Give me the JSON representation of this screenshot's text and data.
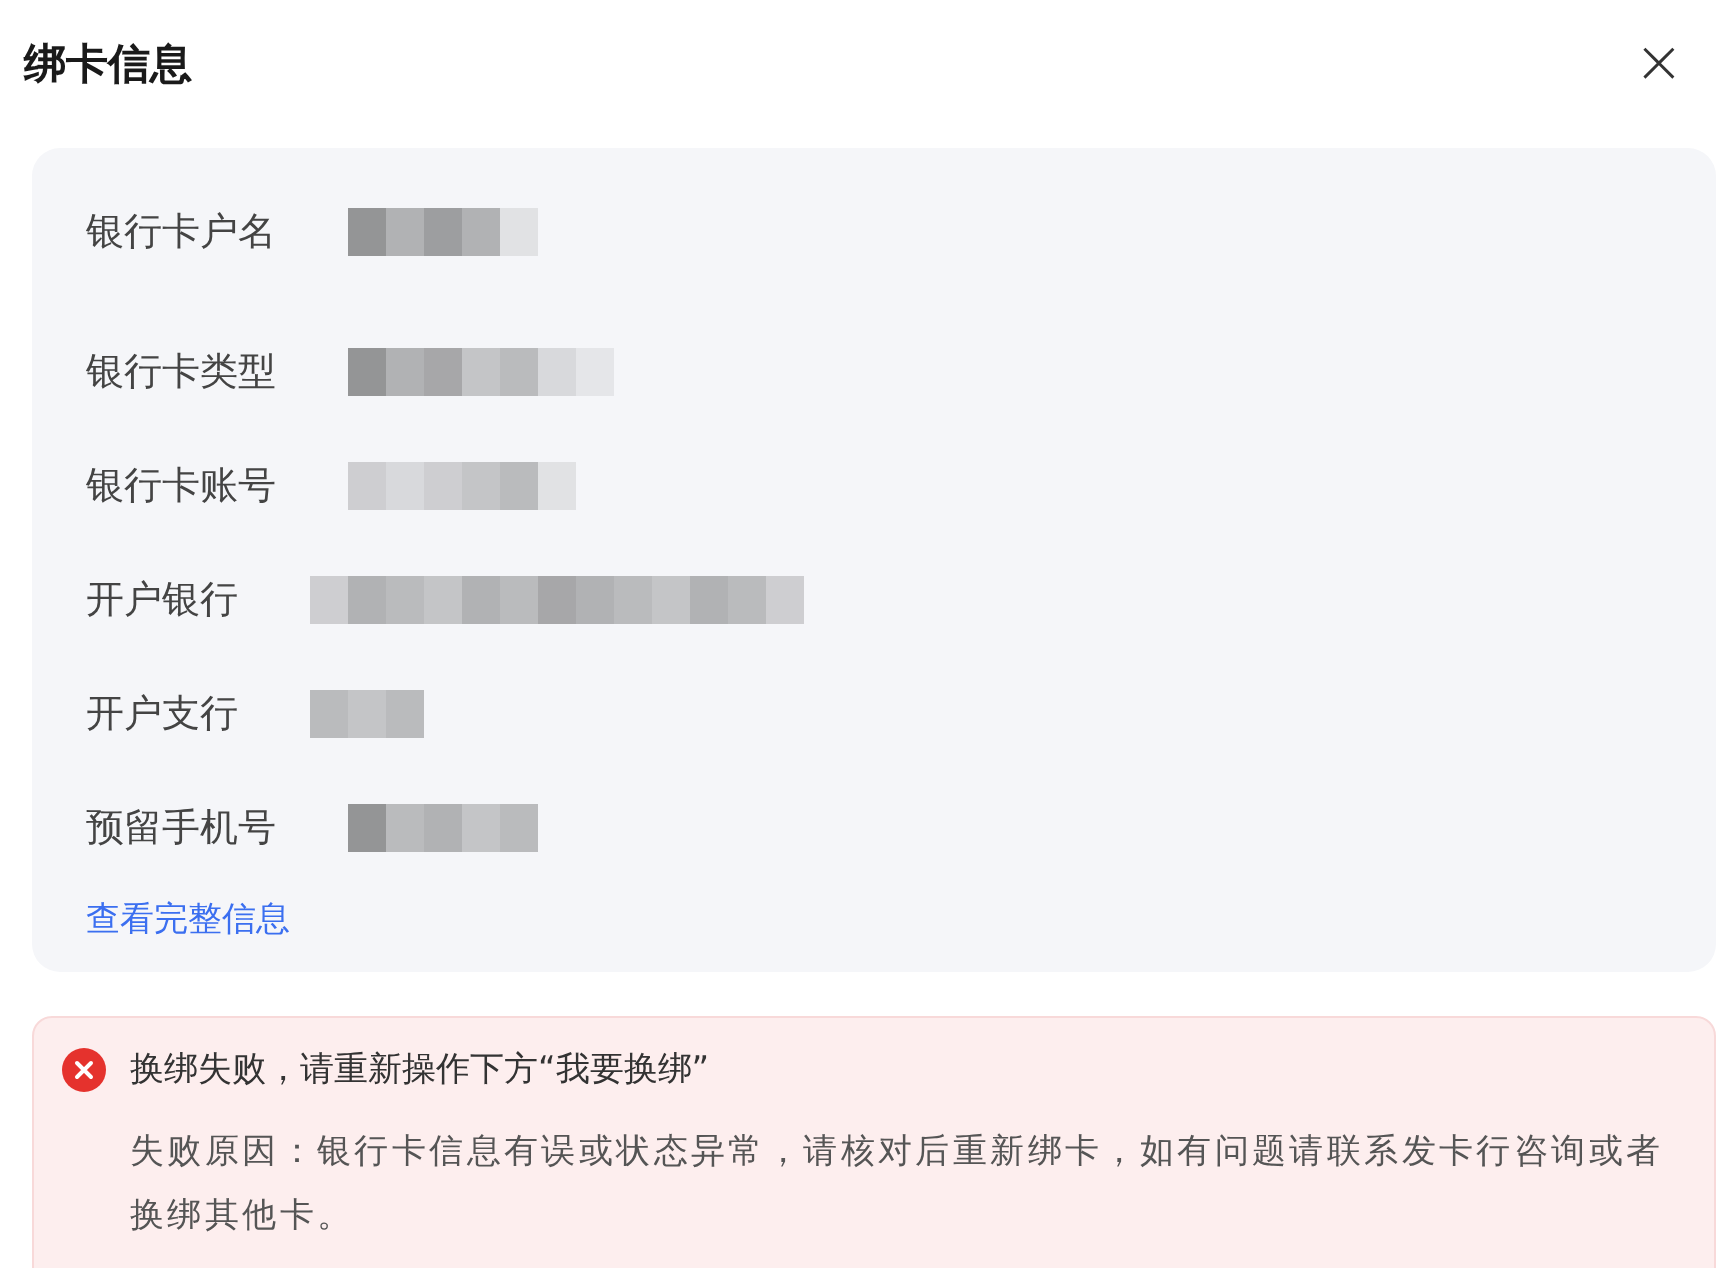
{
  "dialog": {
    "title": "绑卡信息",
    "close": "×"
  },
  "card": {
    "fields": [
      {
        "label": "银行卡户名"
      },
      {
        "label": "银行卡类型"
      },
      {
        "label": "银行卡账号"
      },
      {
        "label": "开户银行"
      },
      {
        "label": "开户支行"
      },
      {
        "label": "预留手机号"
      }
    ],
    "link": "查看完整信息"
  },
  "alert": {
    "kind": "error",
    "title": "换绑失败，请重新操作下方“我要换绑”",
    "message": "失败原因：银行卡信息有误或状态异常，请核对后重新绑卡，如有问题请联系发卡行咨询或者换绑其他卡。"
  }
}
